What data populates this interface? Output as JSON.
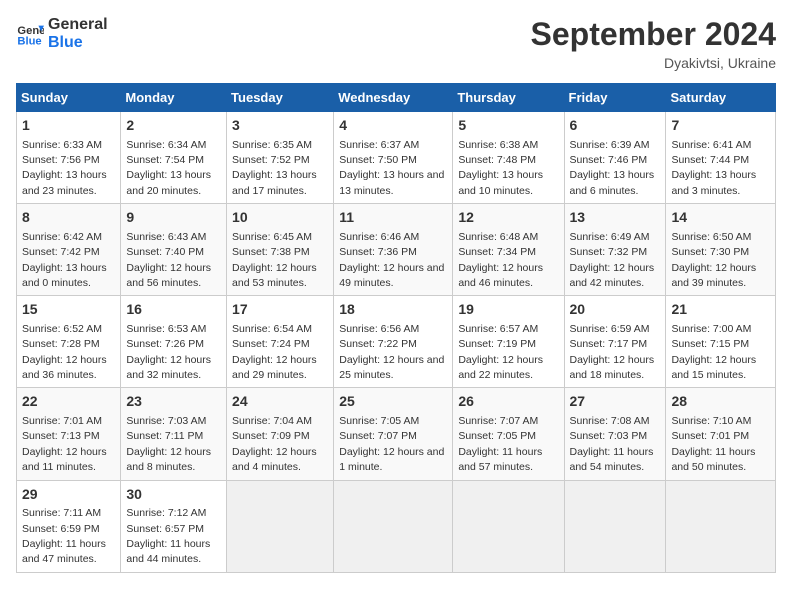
{
  "header": {
    "logo_line1": "General",
    "logo_line2": "Blue",
    "month": "September 2024",
    "location": "Dyakivtsi, Ukraine"
  },
  "days_of_week": [
    "Sunday",
    "Monday",
    "Tuesday",
    "Wednesday",
    "Thursday",
    "Friday",
    "Saturday"
  ],
  "weeks": [
    [
      {
        "num": "1",
        "sunrise": "Sunrise: 6:33 AM",
        "sunset": "Sunset: 7:56 PM",
        "daylight": "Daylight: 13 hours and 23 minutes."
      },
      {
        "num": "2",
        "sunrise": "Sunrise: 6:34 AM",
        "sunset": "Sunset: 7:54 PM",
        "daylight": "Daylight: 13 hours and 20 minutes."
      },
      {
        "num": "3",
        "sunrise": "Sunrise: 6:35 AM",
        "sunset": "Sunset: 7:52 PM",
        "daylight": "Daylight: 13 hours and 17 minutes."
      },
      {
        "num": "4",
        "sunrise": "Sunrise: 6:37 AM",
        "sunset": "Sunset: 7:50 PM",
        "daylight": "Daylight: 13 hours and 13 minutes."
      },
      {
        "num": "5",
        "sunrise": "Sunrise: 6:38 AM",
        "sunset": "Sunset: 7:48 PM",
        "daylight": "Daylight: 13 hours and 10 minutes."
      },
      {
        "num": "6",
        "sunrise": "Sunrise: 6:39 AM",
        "sunset": "Sunset: 7:46 PM",
        "daylight": "Daylight: 13 hours and 6 minutes."
      },
      {
        "num": "7",
        "sunrise": "Sunrise: 6:41 AM",
        "sunset": "Sunset: 7:44 PM",
        "daylight": "Daylight: 13 hours and 3 minutes."
      }
    ],
    [
      {
        "num": "8",
        "sunrise": "Sunrise: 6:42 AM",
        "sunset": "Sunset: 7:42 PM",
        "daylight": "Daylight: 13 hours and 0 minutes."
      },
      {
        "num": "9",
        "sunrise": "Sunrise: 6:43 AM",
        "sunset": "Sunset: 7:40 PM",
        "daylight": "Daylight: 12 hours and 56 minutes."
      },
      {
        "num": "10",
        "sunrise": "Sunrise: 6:45 AM",
        "sunset": "Sunset: 7:38 PM",
        "daylight": "Daylight: 12 hours and 53 minutes."
      },
      {
        "num": "11",
        "sunrise": "Sunrise: 6:46 AM",
        "sunset": "Sunset: 7:36 PM",
        "daylight": "Daylight: 12 hours and 49 minutes."
      },
      {
        "num": "12",
        "sunrise": "Sunrise: 6:48 AM",
        "sunset": "Sunset: 7:34 PM",
        "daylight": "Daylight: 12 hours and 46 minutes."
      },
      {
        "num": "13",
        "sunrise": "Sunrise: 6:49 AM",
        "sunset": "Sunset: 7:32 PM",
        "daylight": "Daylight: 12 hours and 42 minutes."
      },
      {
        "num": "14",
        "sunrise": "Sunrise: 6:50 AM",
        "sunset": "Sunset: 7:30 PM",
        "daylight": "Daylight: 12 hours and 39 minutes."
      }
    ],
    [
      {
        "num": "15",
        "sunrise": "Sunrise: 6:52 AM",
        "sunset": "Sunset: 7:28 PM",
        "daylight": "Daylight: 12 hours and 36 minutes."
      },
      {
        "num": "16",
        "sunrise": "Sunrise: 6:53 AM",
        "sunset": "Sunset: 7:26 PM",
        "daylight": "Daylight: 12 hours and 32 minutes."
      },
      {
        "num": "17",
        "sunrise": "Sunrise: 6:54 AM",
        "sunset": "Sunset: 7:24 PM",
        "daylight": "Daylight: 12 hours and 29 minutes."
      },
      {
        "num": "18",
        "sunrise": "Sunrise: 6:56 AM",
        "sunset": "Sunset: 7:22 PM",
        "daylight": "Daylight: 12 hours and 25 minutes."
      },
      {
        "num": "19",
        "sunrise": "Sunrise: 6:57 AM",
        "sunset": "Sunset: 7:19 PM",
        "daylight": "Daylight: 12 hours and 22 minutes."
      },
      {
        "num": "20",
        "sunrise": "Sunrise: 6:59 AM",
        "sunset": "Sunset: 7:17 PM",
        "daylight": "Daylight: 12 hours and 18 minutes."
      },
      {
        "num": "21",
        "sunrise": "Sunrise: 7:00 AM",
        "sunset": "Sunset: 7:15 PM",
        "daylight": "Daylight: 12 hours and 15 minutes."
      }
    ],
    [
      {
        "num": "22",
        "sunrise": "Sunrise: 7:01 AM",
        "sunset": "Sunset: 7:13 PM",
        "daylight": "Daylight: 12 hours and 11 minutes."
      },
      {
        "num": "23",
        "sunrise": "Sunrise: 7:03 AM",
        "sunset": "Sunset: 7:11 PM",
        "daylight": "Daylight: 12 hours and 8 minutes."
      },
      {
        "num": "24",
        "sunrise": "Sunrise: 7:04 AM",
        "sunset": "Sunset: 7:09 PM",
        "daylight": "Daylight: 12 hours and 4 minutes."
      },
      {
        "num": "25",
        "sunrise": "Sunrise: 7:05 AM",
        "sunset": "Sunset: 7:07 PM",
        "daylight": "Daylight: 12 hours and 1 minute."
      },
      {
        "num": "26",
        "sunrise": "Sunrise: 7:07 AM",
        "sunset": "Sunset: 7:05 PM",
        "daylight": "Daylight: 11 hours and 57 minutes."
      },
      {
        "num": "27",
        "sunrise": "Sunrise: 7:08 AM",
        "sunset": "Sunset: 7:03 PM",
        "daylight": "Daylight: 11 hours and 54 minutes."
      },
      {
        "num": "28",
        "sunrise": "Sunrise: 7:10 AM",
        "sunset": "Sunset: 7:01 PM",
        "daylight": "Daylight: 11 hours and 50 minutes."
      }
    ],
    [
      {
        "num": "29",
        "sunrise": "Sunrise: 7:11 AM",
        "sunset": "Sunset: 6:59 PM",
        "daylight": "Daylight: 11 hours and 47 minutes."
      },
      {
        "num": "30",
        "sunrise": "Sunrise: 7:12 AM",
        "sunset": "Sunset: 6:57 PM",
        "daylight": "Daylight: 11 hours and 44 minutes."
      },
      {
        "num": "",
        "sunrise": "",
        "sunset": "",
        "daylight": ""
      },
      {
        "num": "",
        "sunrise": "",
        "sunset": "",
        "daylight": ""
      },
      {
        "num": "",
        "sunrise": "",
        "sunset": "",
        "daylight": ""
      },
      {
        "num": "",
        "sunrise": "",
        "sunset": "",
        "daylight": ""
      },
      {
        "num": "",
        "sunrise": "",
        "sunset": "",
        "daylight": ""
      }
    ]
  ]
}
